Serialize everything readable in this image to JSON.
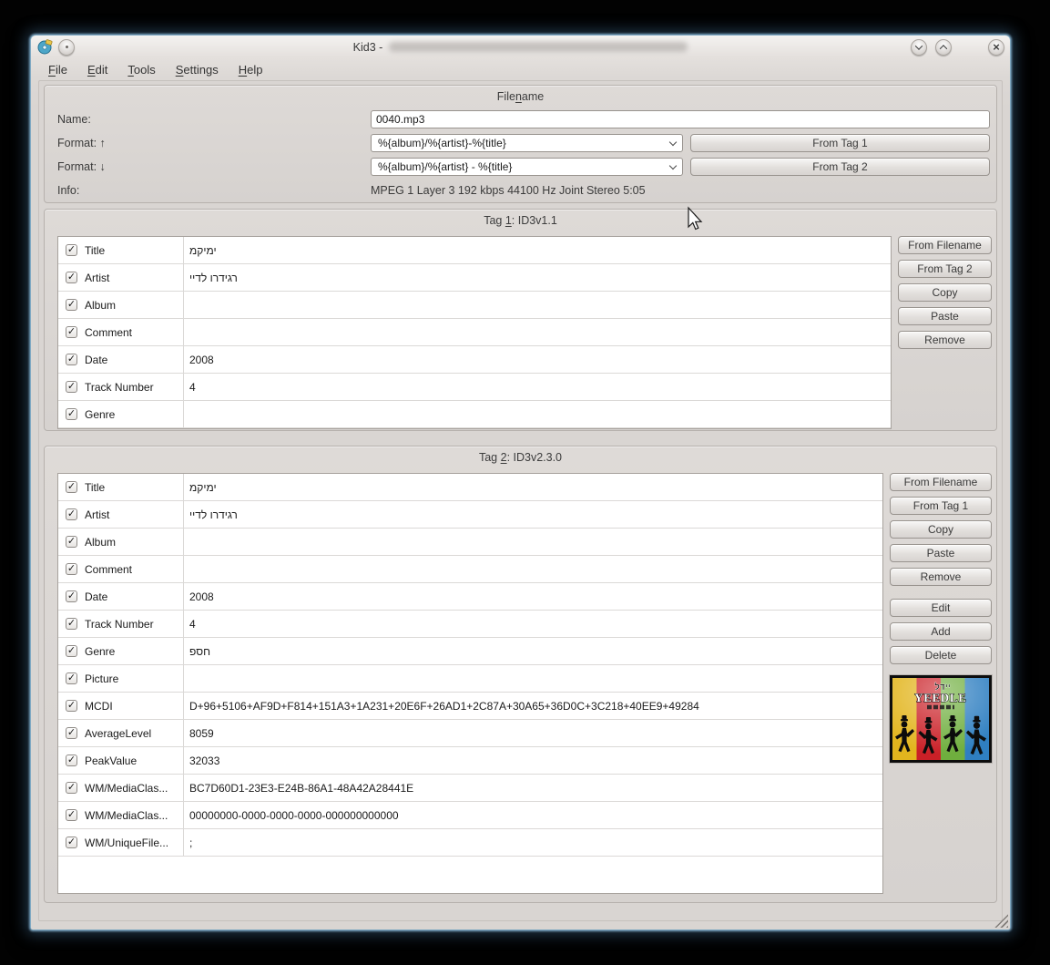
{
  "window": {
    "title_prefix": "Kid3 -",
    "controls": [
      "minimize",
      "maximize",
      "close"
    ]
  },
  "menu": {
    "items": [
      {
        "pre": "",
        "mn": "F",
        "post": "ile"
      },
      {
        "pre": "",
        "mn": "E",
        "post": "dit"
      },
      {
        "pre": "",
        "mn": "T",
        "post": "ools"
      },
      {
        "pre": "",
        "mn": "S",
        "post": "ettings"
      },
      {
        "pre": "",
        "mn": "H",
        "post": "elp"
      }
    ]
  },
  "filename_section": {
    "title": {
      "pre": "File",
      "mn": "n",
      "post": "ame"
    },
    "name_label": "Name:",
    "name_value": "0040.mp3",
    "format_up_label": "Format: ↑",
    "format_up_value": "%{album}/%{artist}-%{title}",
    "from_tag1_button": "From Tag 1",
    "format_down_label": "Format: ↓",
    "format_down_value": "%{album}/%{artist} - %{title}",
    "from_tag2_button": "From Tag 2",
    "info_label": "Info:",
    "info_value": "MPEG 1 Layer 3 192 kbps 44100 Hz Joint Stereo 5:05"
  },
  "tag1": {
    "title": {
      "pre": "Tag ",
      "mn": "1",
      "post": ": ID3v1.1"
    },
    "rows": [
      {
        "label": "Title",
        "value": "מקימי",
        "checked": true
      },
      {
        "label": "Artist",
        "value": "יידל ורדיגר",
        "checked": true
      },
      {
        "label": "Album",
        "value": "",
        "checked": true
      },
      {
        "label": "Comment",
        "value": "",
        "checked": true
      },
      {
        "label": "Date",
        "value": "2008",
        "checked": true
      },
      {
        "label": "Track Number",
        "value": "4",
        "checked": true
      },
      {
        "label": "Genre",
        "value": "",
        "checked": true
      }
    ],
    "buttons": [
      "From Filename",
      "From Tag 2",
      "Copy",
      "Paste",
      "Remove"
    ]
  },
  "tag2": {
    "title": {
      "pre": "Tag ",
      "mn": "2",
      "post": ": ID3v2.3.0"
    },
    "rows": [
      {
        "label": "Title",
        "value": "מקימי",
        "checked": true
      },
      {
        "label": "Artist",
        "value": "יידל ורדיגר",
        "checked": true
      },
      {
        "label": "Album",
        "value": "",
        "checked": true
      },
      {
        "label": "Comment",
        "value": "",
        "checked": true
      },
      {
        "label": "Date",
        "value": "2008",
        "checked": true
      },
      {
        "label": "Track Number",
        "value": "4",
        "checked": true
      },
      {
        "label": "Genre",
        "value": "פסח",
        "checked": true
      },
      {
        "label": "Picture",
        "value": "",
        "checked": true
      },
      {
        "label": "MCDI",
        "value": "D+96+5106+AF9D+F814+151A3+1A231+20E6F+26AD1+2C87A+30A65+36D0C+3C218+40EE9+49284",
        "checked": true
      },
      {
        "label": "AverageLevel",
        "value": "8059",
        "checked": true
      },
      {
        "label": "PeakValue",
        "value": "32033",
        "checked": true
      },
      {
        "label": "WM/MediaClas...",
        "value": "BC7D60D1-23E3-E24B-86A1-48A42A28441E",
        "checked": true
      },
      {
        "label": "WM/MediaClas...",
        "value": "00000000-0000-0000-0000-000000000000",
        "checked": true
      },
      {
        "label": "WM/UniqueFile...",
        "value": ";",
        "checked": true
      }
    ],
    "buttons_top": [
      "From Filename",
      "From Tag 1",
      "Copy",
      "Paste",
      "Remove"
    ],
    "buttons_bottom": [
      "Edit",
      "Add",
      "Delete"
    ],
    "album_art": {
      "latin_text": "YEEDLE",
      "hebrew_text": "יידל",
      "stripe_colors": [
        "#e2b51e",
        "#ca2027",
        "#6fae3e",
        "#2f7fc1"
      ]
    }
  },
  "theme": {
    "window_bg": "#d9d5d2",
    "titlebar_highlight": "#f4f2f0",
    "table_bg": "#ffffff",
    "border": "#98938e",
    "window_glow": "#86b6d4",
    "text": "#3a3a3a"
  }
}
